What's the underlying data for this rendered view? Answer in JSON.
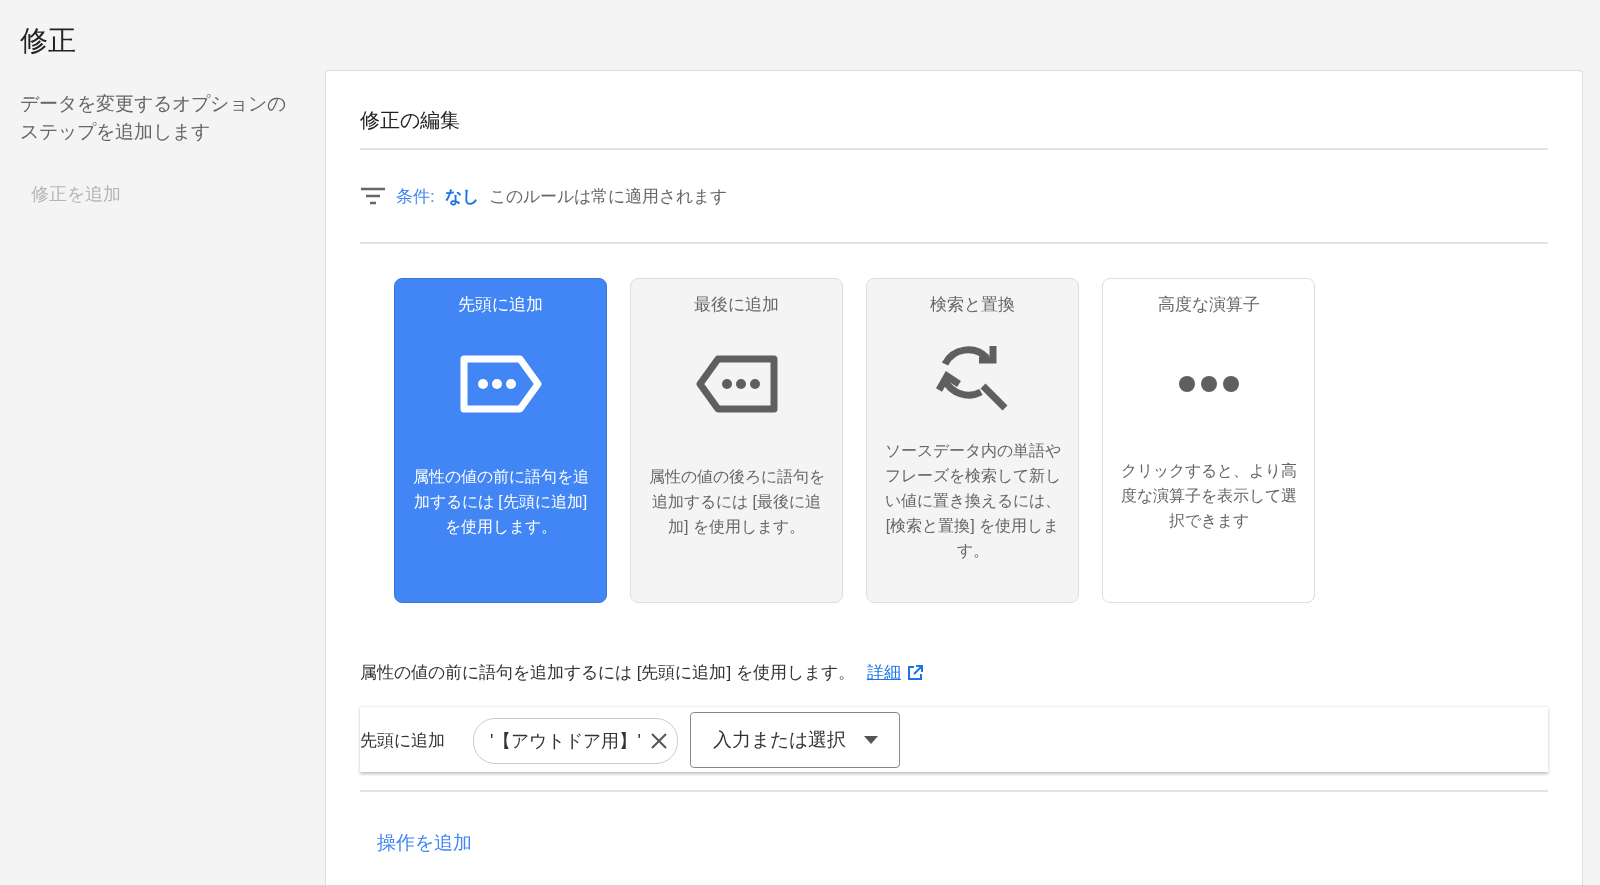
{
  "page": {
    "title": "修正",
    "description": "データを変更するオプションのステップを追加します",
    "add_link": "修正を追加"
  },
  "editor": {
    "title": "修正の編集",
    "condition": {
      "label": "条件:",
      "value": "なし",
      "note": "このルールは常に適用されます"
    },
    "operations": [
      {
        "kind": "prepend",
        "title": "先頭に追加",
        "description": "属性の値の前に語句を追加するには [先頭に追加] を使用します。",
        "selected": true
      },
      {
        "kind": "append",
        "title": "最後に追加",
        "description": "属性の値の後ろに語句を追加するには [最後に追加] を使用します。",
        "selected": false
      },
      {
        "kind": "replace",
        "title": "検索と置換",
        "description": "ソースデータ内の単語やフレーズを検索して新しい値に置き換えるには、[検索と置換] を使用します。",
        "selected": false
      },
      {
        "kind": "more",
        "title": "高度な演算子",
        "description": "クリックすると、より高度な演算子を表示して選択できます",
        "selected": false
      }
    ],
    "help": {
      "text": "属性の値の前に語句を追加するには [先頭に追加] を使用します。",
      "link": "詳細"
    },
    "step": {
      "label": "先頭に追加",
      "chips": [
        {
          "text": "'【アウトドア用】'"
        }
      ],
      "select": {
        "placeholder": "入力または選択"
      }
    },
    "add_action": "操作を追加"
  }
}
